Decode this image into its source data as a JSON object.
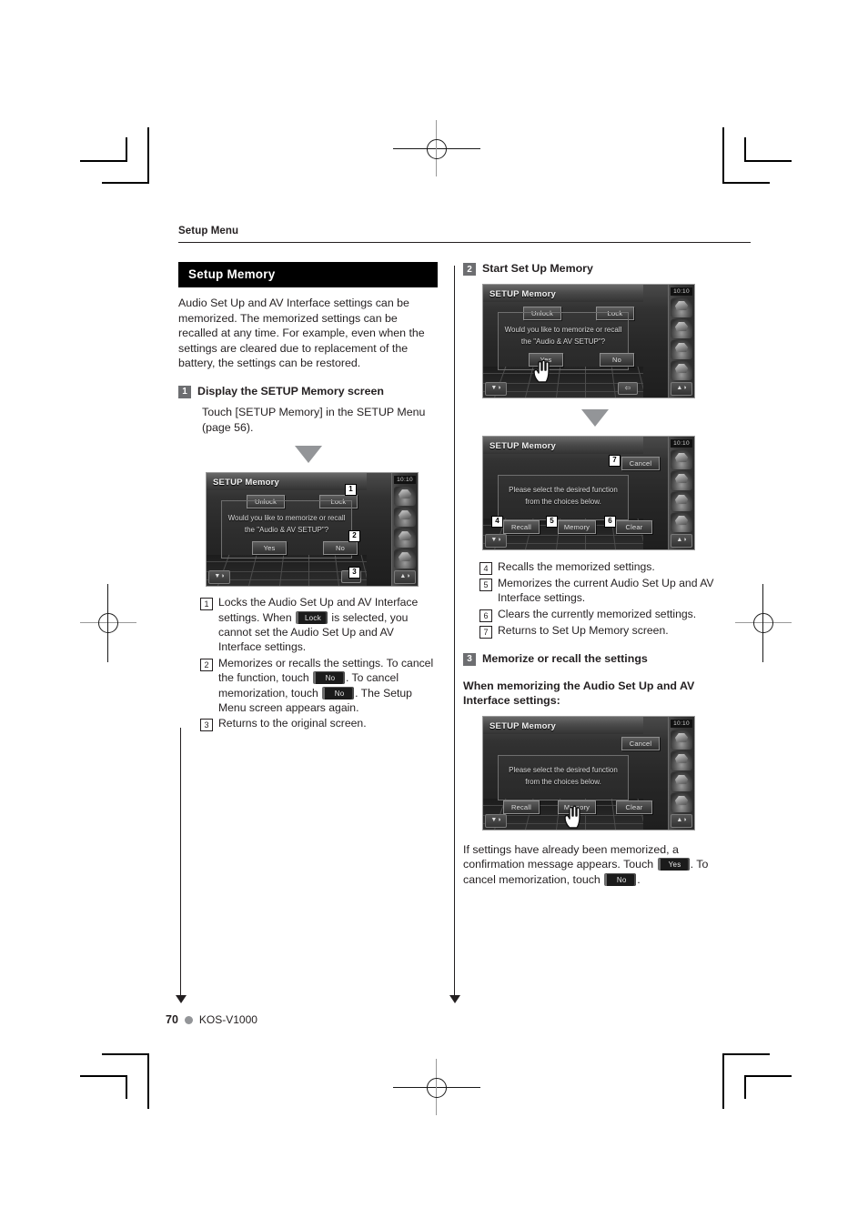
{
  "page": {
    "running_head": "Setup Menu",
    "footer": {
      "page_number": "70",
      "model": "KOS-V1000"
    }
  },
  "left_column": {
    "section_title": "Setup Memory",
    "intro": "Audio Set Up and AV Interface settings can be memorized. The memorized settings can be recalled at any time. For example, even when the settings are cleared due to replacement of the battery, the settings can be restored.",
    "step1": {
      "number": "1",
      "title": "Display the SETUP Memory screen",
      "body": "Touch [SETUP Memory] in the SETUP Menu (page 56)."
    },
    "screen1": {
      "title": "SETUP Memory",
      "clock": "10:10",
      "unlock_label": "Unlock",
      "lock_label": "Lock",
      "message_line1": "Would you like to memorize or recall",
      "message_line2": "the \"Audio & AV SETUP\"?",
      "yes_label": "Yes",
      "no_label": "No",
      "tag_lock": "1",
      "tag_no": "2",
      "tag_return": "3"
    },
    "callouts": [
      {
        "num": "1",
        "parts": [
          {
            "type": "text",
            "value": "Locks the Audio Set Up and AV Interface settings. When "
          },
          {
            "type": "key",
            "value": "Lock"
          },
          {
            "type": "text",
            "value": " is selected, you cannot set the Audio Set Up and AV Interface settings."
          }
        ]
      },
      {
        "num": "2",
        "parts": [
          {
            "type": "text",
            "value": "Memorizes or recalls the settings. To cancel the function, touch "
          },
          {
            "type": "key",
            "value": "No"
          },
          {
            "type": "text",
            "value": ". To cancel memorization, touch "
          },
          {
            "type": "key",
            "value": "No"
          },
          {
            "type": "text",
            "value": ". The Setup Menu screen appears again."
          }
        ]
      },
      {
        "num": "3",
        "parts": [
          {
            "type": "text",
            "value": "Returns to the original screen."
          }
        ]
      }
    ]
  },
  "right_column": {
    "step2": {
      "number": "2",
      "title": "Start Set Up Memory"
    },
    "screen2": {
      "title": "SETUP Memory",
      "clock": "10:10",
      "unlock_label": "Unlock",
      "lock_label": "Lock",
      "message_line1": "Would you like to memorize or recall",
      "message_line2": "the \"Audio & AV SETUP\"?",
      "yes_label": "Yes",
      "no_label": "No",
      "cursor_on": "Yes"
    },
    "screen3": {
      "title": "SETUP Memory",
      "clock": "10:10",
      "cancel_label": "Cancel",
      "message_line1": "Please select the desired function",
      "message_line2": "from the choices below.",
      "recall_label": "Recall",
      "memory_label": "Memory",
      "clear_label": "Clear",
      "tag_cancel": "7",
      "tag_recall": "4",
      "tag_memory": "5",
      "tag_clear": "6"
    },
    "callouts": [
      {
        "num": "4",
        "text": "Recalls the memorized settings."
      },
      {
        "num": "5",
        "text": "Memorizes the current Audio Set Up and AV Interface settings."
      },
      {
        "num": "6",
        "text": "Clears the currently memorized settings."
      },
      {
        "num": "7",
        "text": "Returns to Set Up Memory screen."
      }
    ],
    "step3": {
      "number": "3",
      "title": "Memorize or recall the settings"
    },
    "subhead": "When memorizing the Audio Set Up and AV Interface settings:",
    "screen4": {
      "title": "SETUP Memory",
      "clock": "10:10",
      "cancel_label": "Cancel",
      "message_line1": "Please select the desired function",
      "message_line2": "from the choices below.",
      "recall_label": "Recall",
      "memory_label": "Memory",
      "clear_label": "Clear",
      "cursor_on": "Memory"
    },
    "closing": {
      "parts": [
        {
          "type": "text",
          "value": "If settings have already been memorized, a confirmation message appears. Touch "
        },
        {
          "type": "key",
          "value": "Yes"
        },
        {
          "type": "text",
          "value": ". To cancel memorization, touch "
        },
        {
          "type": "key",
          "value": "No"
        },
        {
          "type": "text",
          "value": "."
        }
      ]
    }
  }
}
